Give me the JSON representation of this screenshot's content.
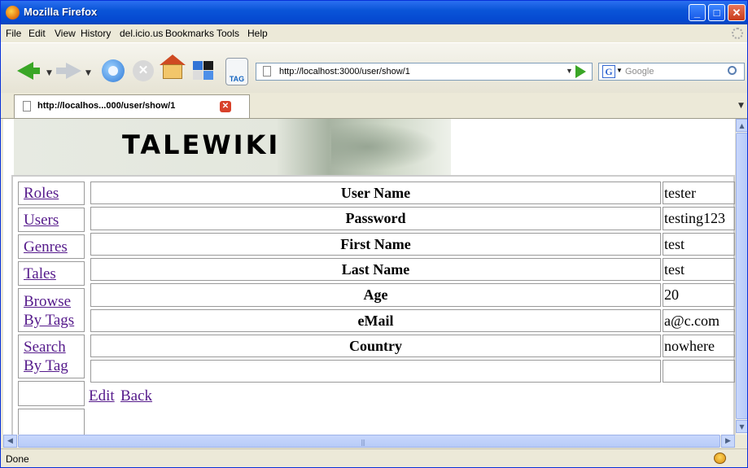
{
  "window": {
    "title": "Mozilla Firefox",
    "min": "_",
    "max": "□",
    "close": "✕"
  },
  "menu": [
    "File",
    "Edit",
    "View",
    "History",
    "del.icio.us",
    "Bookmarks",
    "Tools",
    "Help"
  ],
  "nav": {
    "url": "http://localhost:3000/user/show/1",
    "search_placeholder": "Google",
    "tag_label": "TAG",
    "stop_glyph": "✕",
    "dropdown_glyph": "▼"
  },
  "tab": {
    "title": "http://localhos...000/user/show/1",
    "close": "✕"
  },
  "page": {
    "logo": "TALEWIKI",
    "nav_links": [
      [
        "Roles"
      ],
      [
        "Users"
      ],
      [
        "Genres"
      ],
      [
        "Tales"
      ],
      [
        "Browse",
        "By Tags"
      ],
      [
        "Search",
        "By Tag"
      ]
    ],
    "fields": [
      {
        "label": "User Name",
        "value": "tester"
      },
      {
        "label": "Password",
        "value": "testing123"
      },
      {
        "label": "First Name",
        "value": "test"
      },
      {
        "label": "Last Name",
        "value": "test"
      },
      {
        "label": "Age",
        "value": "20"
      },
      {
        "label": "eMail",
        "value": "a@c.com"
      },
      {
        "label": "Country",
        "value": "nowhere"
      },
      {
        "label": "",
        "value": ""
      }
    ],
    "actions": {
      "edit": "Edit",
      "back": "Back"
    }
  },
  "status": {
    "text": "Done"
  },
  "colors": {
    "link": "#551a8b",
    "titlebar": "#0a55d8"
  }
}
